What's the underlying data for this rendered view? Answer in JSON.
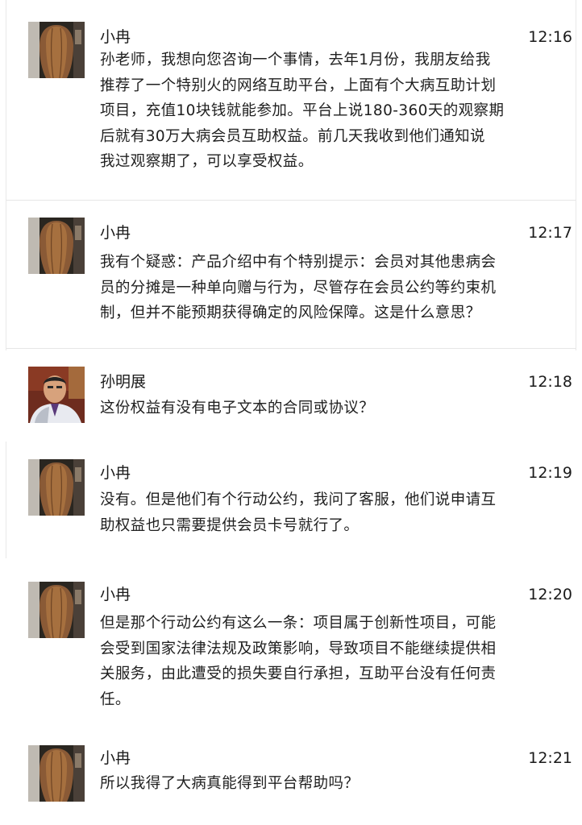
{
  "messages": [
    {
      "sender": "小冉",
      "time": "12:16",
      "avatar": "long-hair-avatar-icon",
      "lines": [
        "孙老师，我想向您咨询一个事情，去年1月份，我朋友给我",
        "推荐了一个特别火的网络互助平台，上面有个大病互助计划",
        "项目，充值10块钱就能参加。平台上说180-360天的观察期",
        "后就有30万大病会员互助权益。前几天我收到他们通知说",
        "我过观察期了，可以享受权益。"
      ]
    },
    {
      "sender": "小冉",
      "time": "12:17",
      "avatar": "long-hair-avatar-icon",
      "lines": [
        "我有个疑惑：产品介绍中有个特别提示：会员对其他患病会",
        "员的分摊是一种单向赠与行为，尽管存在会员公约等约束机",
        "制，但并不能预期获得确定的风险保障。这是什么意思？"
      ]
    },
    {
      "sender": "孙明展",
      "time": "12:18",
      "avatar": "man-portrait-avatar-icon",
      "lines": [
        "这份权益有没有电子文本的合同或协议？"
      ]
    },
    {
      "sender": "小冉",
      "time": "12:19",
      "avatar": "long-hair-avatar-icon",
      "lines": [
        "没有。但是他们有个行动公约，我问了客服，他们说申请互",
        "助权益也只需要提供会员卡号就行了。"
      ]
    },
    {
      "sender": "小冉",
      "time": "12:20",
      "avatar": "long-hair-avatar-icon",
      "lines": [
        "但是那个行动公约有这么一条：项目属于创新性项目，可能",
        "会受到国家法律法规及政策影响，导致项目不能继续提供相",
        "关服务，由此遭受的损失要自行承担，互助平台没有任何责",
        "任。"
      ]
    },
    {
      "sender": "小冉",
      "time": "12:21",
      "avatar": "long-hair-avatar-icon",
      "lines": [
        "所以我得了大病真能得到平台帮助吗？"
      ]
    }
  ]
}
